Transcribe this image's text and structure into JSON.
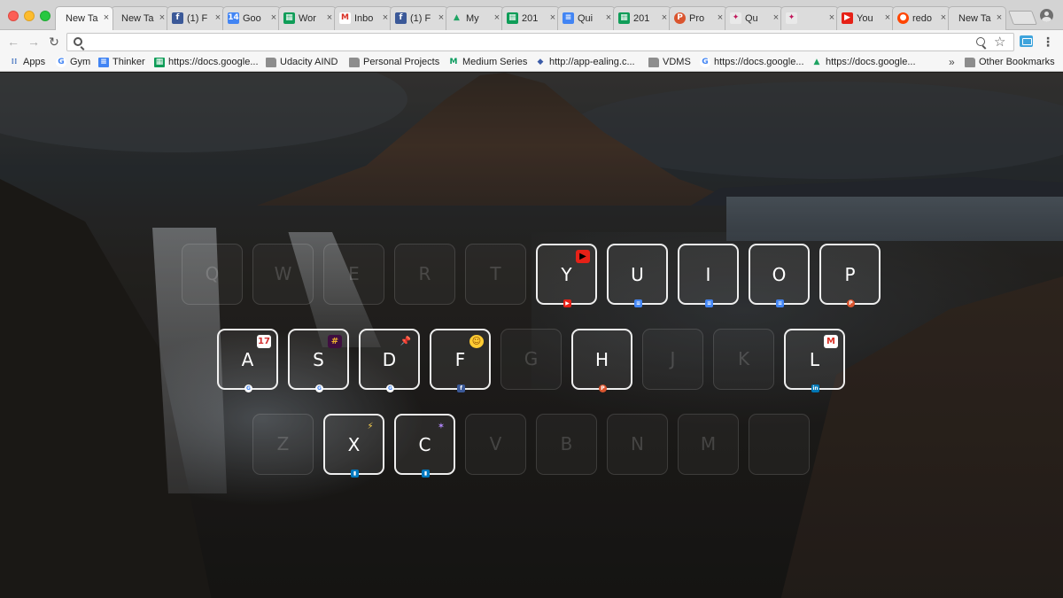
{
  "tabs": [
    {
      "label": "New Ta",
      "icon": "none",
      "active": true
    },
    {
      "label": "New Ta",
      "icon": "none"
    },
    {
      "label": "(1) F",
      "icon": "facebook-icon"
    },
    {
      "label": "Goo",
      "icon": "google-calendar-icon"
    },
    {
      "label": "Wor",
      "icon": "google-sheets-icon"
    },
    {
      "label": "Inbo",
      "icon": "gmail-icon"
    },
    {
      "label": "(1) F",
      "icon": "facebook-icon"
    },
    {
      "label": "My",
      "icon": "google-drive-icon"
    },
    {
      "label": "201",
      "icon": "google-sheets-icon"
    },
    {
      "label": "Qui",
      "icon": "google-docs-icon"
    },
    {
      "label": "201",
      "icon": "google-sheets-icon"
    },
    {
      "label": "Pro",
      "icon": "product-hunt-icon"
    },
    {
      "label": "Qu",
      "icon": "colorful-app-icon"
    },
    {
      "label": "",
      "icon": "colorful-app-icon"
    },
    {
      "label": "You",
      "icon": "youtube-icon"
    },
    {
      "label": "redo",
      "icon": "reddit-icon"
    },
    {
      "label": "New Ta",
      "icon": "none"
    }
  ],
  "toolbar": {
    "address_value": "",
    "address_placeholder": ""
  },
  "bookmarks": [
    {
      "label": "Apps",
      "icon": "apps-grid-icon"
    },
    {
      "label": "Gym",
      "icon": "google-icon"
    },
    {
      "label": "Thinker",
      "icon": "google-docs-icon"
    },
    {
      "label": "https://docs.google...",
      "icon": "google-sheets-icon"
    },
    {
      "label": "Udacity AIND",
      "icon": "folder-icon"
    },
    {
      "label": "Personal Projects",
      "icon": "folder-icon"
    },
    {
      "label": "Medium Series",
      "icon": "medium-icon"
    },
    {
      "label": "http://app-ealing.c...",
      "icon": "globe-icon"
    },
    {
      "label": "VDMS",
      "icon": "folder-icon"
    },
    {
      "label": "https://docs.google...",
      "icon": "google-icon"
    },
    {
      "label": "https://docs.google...",
      "icon": "google-drive-icon"
    }
  ],
  "other_bookmarks": "Other Bookmarks",
  "keyboard": {
    "rows": [
      [
        {
          "letter": "Q",
          "active": false
        },
        {
          "letter": "W",
          "active": false
        },
        {
          "letter": "E",
          "active": false
        },
        {
          "letter": "R",
          "active": false
        },
        {
          "letter": "T",
          "active": false
        },
        {
          "letter": "Y",
          "active": true,
          "icon": "youtube-icon",
          "badge": "youtube-icon"
        },
        {
          "letter": "U",
          "active": true,
          "badge": "google-docs-icon"
        },
        {
          "letter": "I",
          "active": true,
          "badge": "google-docs-icon"
        },
        {
          "letter": "O",
          "active": true,
          "badge": "google-docs-icon"
        },
        {
          "letter": "P",
          "active": true,
          "badge": "product-hunt-icon"
        }
      ],
      [
        {
          "letter": "A",
          "active": true,
          "icon": "calendar-icon",
          "badge": "google-icon"
        },
        {
          "letter": "S",
          "active": true,
          "icon": "slack-icon",
          "badge": "google-icon"
        },
        {
          "letter": "D",
          "active": true,
          "icon": "pin-icon",
          "badge": "google-icon"
        },
        {
          "letter": "F",
          "active": true,
          "icon": "emoji-icon",
          "badge": "facebook-icon"
        },
        {
          "letter": "G",
          "active": false
        },
        {
          "letter": "H",
          "active": true,
          "badge": "product-hunt-icon"
        },
        {
          "letter": "J",
          "active": false
        },
        {
          "letter": "K",
          "active": false
        },
        {
          "letter": "L",
          "active": true,
          "icon": "gmail-icon",
          "badge": "linkedin-icon"
        }
      ],
      [
        {
          "letter": "Z",
          "active": false
        },
        {
          "letter": "X",
          "active": true,
          "icon": "lightning-icon",
          "badge": "trello-icon"
        },
        {
          "letter": "C",
          "active": true,
          "icon": "wand-icon",
          "badge": "trello-icon"
        },
        {
          "letter": "V",
          "active": false
        },
        {
          "letter": "B",
          "active": false
        },
        {
          "letter": "N",
          "active": false
        },
        {
          "letter": "M",
          "active": false
        },
        {
          "letter": "",
          "active": false
        }
      ]
    ]
  },
  "colors": {
    "facebook": "#3b5998",
    "youtube": "#e62117",
    "docs": "#4285f4",
    "sheets": "#0f9d58",
    "gmail": "#d93025",
    "product_hunt": "#da552f",
    "reddit": "#ff4500",
    "linkedin": "#0077b5",
    "trello": "#0079bf",
    "drive": "#1fa463",
    "google": "#4285f4"
  }
}
